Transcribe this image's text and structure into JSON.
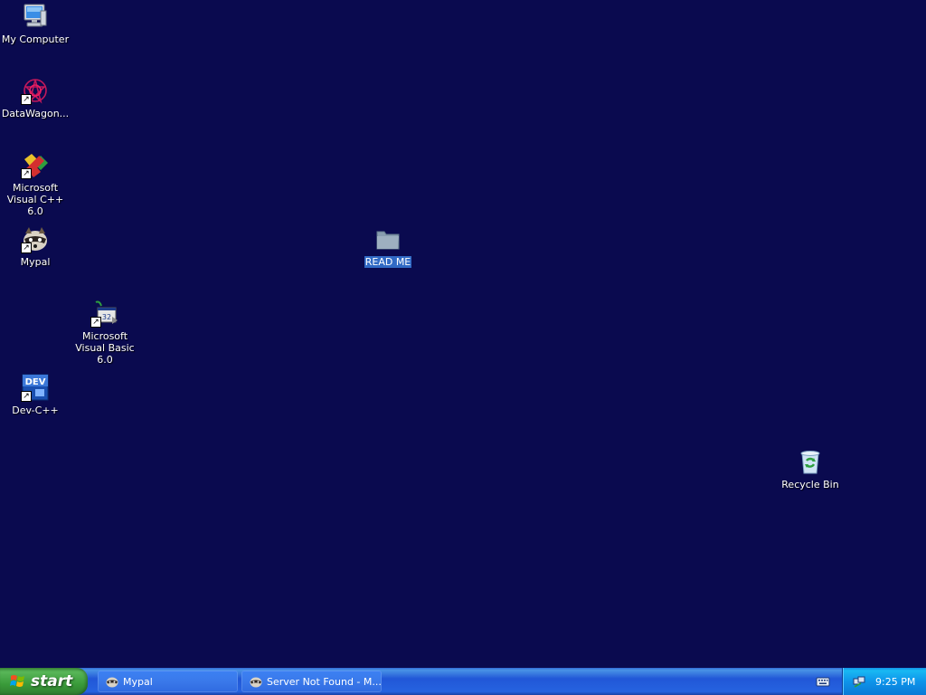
{
  "desktop": {
    "icons": [
      {
        "id": "my-computer",
        "label": "My Computer",
        "icon": "computer-icon",
        "shortcut": false
      },
      {
        "id": "datawagon",
        "label": "DataWagon...",
        "icon": "datawagon-icon",
        "shortcut": true
      },
      {
        "id": "msvc",
        "label": "Microsoft Visual C++ 6.0",
        "icon": "visual-cpp-icon",
        "shortcut": true
      },
      {
        "id": "mypal",
        "label": "Mypal",
        "icon": "mypal-raccoon-icon",
        "shortcut": true
      },
      {
        "id": "msvb",
        "label": "Microsoft Visual Basic 6.0",
        "icon": "visual-basic-icon",
        "shortcut": true
      },
      {
        "id": "devcpp",
        "label": "Dev-C++",
        "icon": "dev-cpp-icon",
        "shortcut": true
      },
      {
        "id": "readme",
        "label": "READ ME",
        "icon": "folder-icon",
        "shortcut": false,
        "selected": true
      },
      {
        "id": "recycle",
        "label": "Recycle Bin",
        "icon": "recycle-bin-icon",
        "shortcut": false
      }
    ]
  },
  "taskbar": {
    "start_label": "start",
    "tasks": [
      {
        "label": "Mypal",
        "icon": "mypal-raccoon-icon"
      },
      {
        "label": "Server Not Found - M...",
        "icon": "mypal-raccoon-icon"
      }
    ],
    "tray": {
      "clock": "9:25 PM"
    }
  },
  "colors": {
    "desktop_bg": "#0a0a4f",
    "selection": "#316ac5",
    "taskbar_blue": "#2157d7",
    "start_green": "#3a9b3a"
  }
}
